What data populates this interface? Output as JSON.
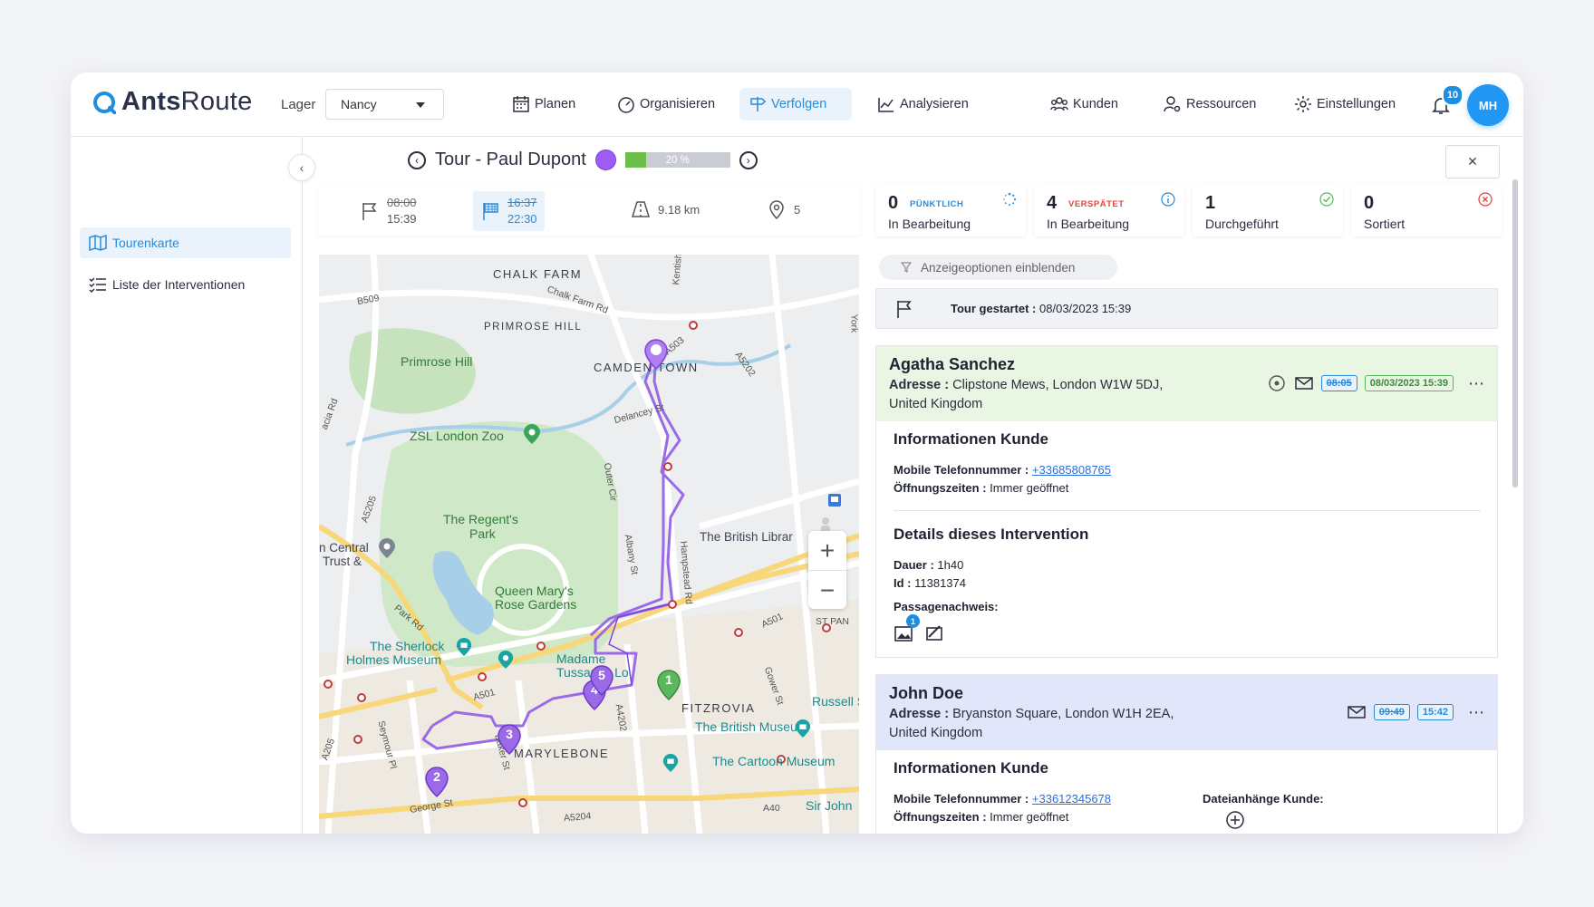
{
  "app": {
    "brand_prefix": "Ants",
    "brand_suffix": "Route",
    "lager_label": "Lager",
    "lager_value": "Nancy",
    "nav": [
      {
        "label": "Planen",
        "icon": "calendar-icon"
      },
      {
        "label": "Organisieren",
        "icon": "gauge-icon"
      },
      {
        "label": "Verfolgen",
        "icon": "signpost-icon"
      },
      {
        "label": "Analysieren",
        "icon": "chart-icon"
      },
      {
        "label": "Kunden",
        "icon": "users-icon"
      },
      {
        "label": "Ressourcen",
        "icon": "user-gear-icon"
      },
      {
        "label": "Einstellungen",
        "icon": "gear-icon"
      }
    ],
    "active_nav": "Verfolgen",
    "notifications": "10",
    "avatar": "MH",
    "accent": "#2196f3"
  },
  "sidebar": {
    "items": [
      {
        "label": "Tourenkarte",
        "icon": "map-icon"
      },
      {
        "label": "Liste der Interventionen",
        "icon": "list-icon"
      }
    ]
  },
  "tour": {
    "title": "Tour - Paul Dupont",
    "color": "#9c5cf5",
    "progress_text": "20 %",
    "progress": 0.2,
    "start_planned": "08:00",
    "start_actual": "15:39",
    "end_planned": "16:37",
    "end_actual": "22:30",
    "distance": "9.18 km",
    "stops": "5"
  },
  "kpis": [
    {
      "num": "0",
      "tag": "PÜNKTLICH",
      "tag_color": "#2a8bd8",
      "label": "In Bearbeitung",
      "icon": "spinner-icon"
    },
    {
      "num": "4",
      "tag": "VERSPÄTET",
      "tag_color": "#e0453a",
      "label": "In Bearbeitung",
      "icon": "info-icon"
    },
    {
      "num": "1",
      "tag": "",
      "tag_color": "",
      "label": "Durchgeführt",
      "icon": "check-circle-icon"
    },
    {
      "num": "0",
      "tag": "",
      "tag_color": "",
      "label": "Sortiert",
      "icon": "x-circle-icon"
    }
  ],
  "filter_label": "Anzeigeoptionen einblenden",
  "tour_started": {
    "label": "Tour gestartet :",
    "value": "08/03/2023 15:39"
  },
  "cards": [
    {
      "name": "Agatha Sanchez",
      "addr_label": "Adresse :",
      "address": "Clipstone Mews, London W1W 5DJ, United Kingdom",
      "planned": "08:05",
      "actual": "08/03/2023 15:39",
      "info_title": "Informationen Kunde",
      "phone_label": "Mobile Telefonnummer :",
      "phone": "+33685808765",
      "hours_label": "Öffnungszeiten :",
      "hours": "Immer geöffnet",
      "details_title": "Details dieses Intervention",
      "duration_label": "Dauer :",
      "duration": "1h40",
      "id_label": "Id :",
      "id": "11381374",
      "proof_label": "Passagenachweis:",
      "proof_count": "1"
    },
    {
      "name": "John Doe",
      "addr_label": "Adresse :",
      "address": "Bryanston Square, London W1H 2EA, United Kingdom",
      "planned": "09:49",
      "actual": "15:42",
      "info_title": "Informationen Kunde",
      "phone_label": "Mobile Telefonnummer :",
      "phone": "+33612345678",
      "hours_label": "Öffnungszeiten :",
      "hours": "Immer geöffnet",
      "attach_label": "Dateianhänge Kunde:"
    }
  ],
  "map": {
    "labels": {
      "chalk_farm": "CHALK FARM",
      "primrose_hill_area": "PRIMROSE HILL",
      "primrose_hill": "Primrose Hill",
      "camden": "CAMDEN TOWN",
      "zoo": "ZSL London Zoo",
      "regents_1": "The Regent's",
      "regents_2": "Park",
      "queen_1": "Queen Mary's",
      "queen_2": "Rose Gardens",
      "sherlock_1": "The Sherlock",
      "sherlock_2": "Holmes Museum",
      "tussauds_1": "Madame",
      "tussauds_2": "Tussauds Lo",
      "fitzrovia": "FITZROVIA",
      "marylebone": "MARYLEBONE",
      "british_museum": "The British Museum",
      "cartoon": "The Cartoon Museum",
      "british_library": "The British Librar",
      "russell": "Russell S",
      "sir_john": "Sir John",
      "central_1": "n Central",
      "central_2": "Trust &",
      "b509": "B509",
      "chalk_farm_rd": "Chalk Farm Rd",
      "a503": "A503",
      "a5202": "A5202",
      "delancey": "Delancey St",
      "outer_cir": "Outer Cir",
      "albany": "Albany St",
      "hampstead": "Hampstead Rd",
      "park_rd": "Park Rd",
      "a501_left": "A501",
      "a501_right": "A501",
      "a5205": "A5205",
      "seymour": "Seymour Pl",
      "baker": "Baker St",
      "a4204": "A5204",
      "george": "George St",
      "a40": "A40",
      "m20": "A4202",
      "gower": "Gower St",
      "kentish": "Kentish",
      "york": "York",
      "st_pan": "ST PAN",
      "acia_rd": "acia Rd",
      "a205": "A205"
    },
    "stops": [
      "1",
      "2",
      "3",
      "4",
      "5"
    ]
  }
}
